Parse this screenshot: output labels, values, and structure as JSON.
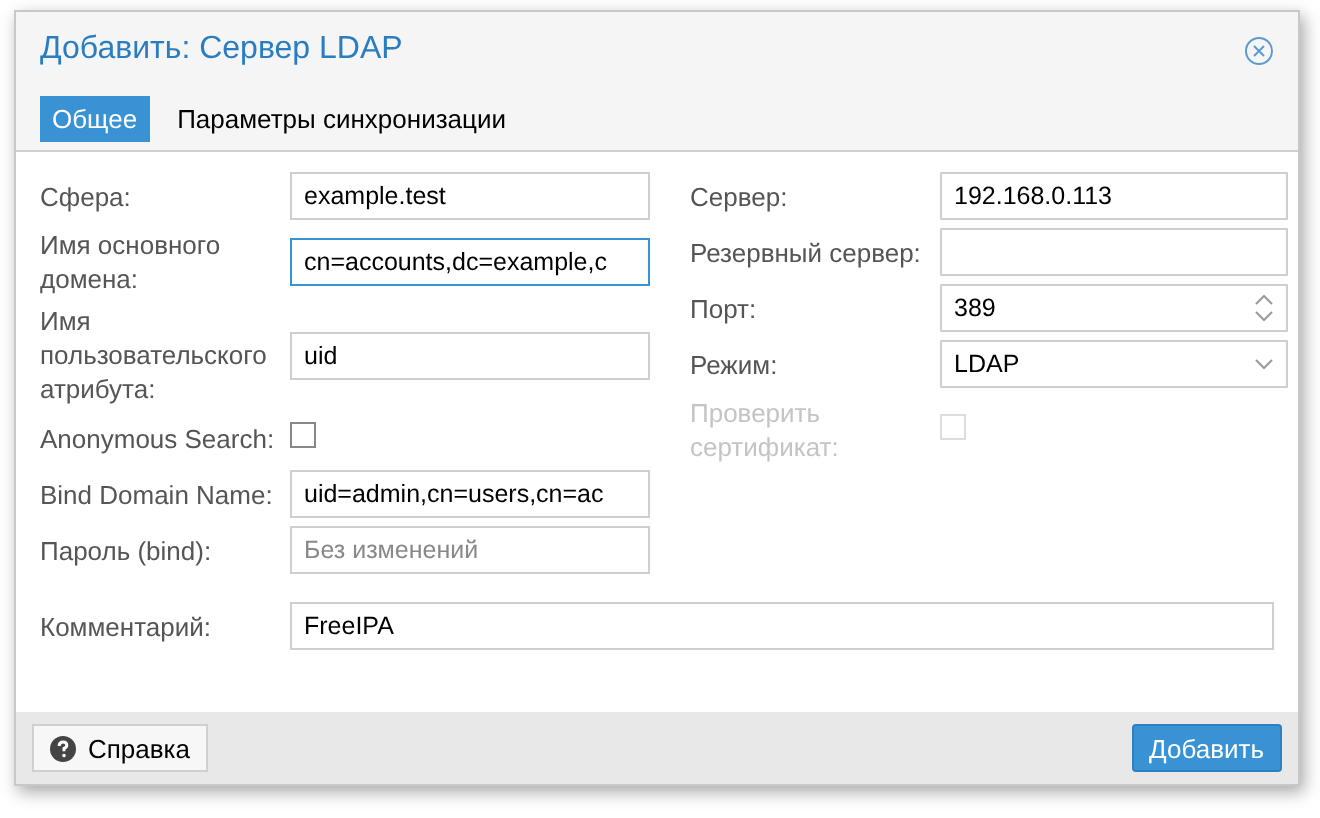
{
  "window": {
    "title": "Добавить: Сервер LDAP"
  },
  "tabs": [
    {
      "label": "Общее",
      "selected": true
    },
    {
      "label": "Параметры синхронизации",
      "selected": false
    }
  ],
  "left_fields": [
    {
      "kind": "text",
      "label": "Сфера:",
      "value": "example.test",
      "focused": false
    },
    {
      "kind": "text",
      "label": "Имя основного домена:",
      "value": "cn=accounts,dc=example,c",
      "focused": true
    },
    {
      "kind": "text",
      "label": "Имя пользовательского атрибута:",
      "value": "uid",
      "focused": false
    },
    {
      "kind": "checkbox",
      "label": "Anonymous Search:",
      "checked": false,
      "disabled": false
    },
    {
      "kind": "text",
      "label": "Bind Domain Name:",
      "value": "uid=admin,cn=users,cn=ac",
      "focused": false
    },
    {
      "kind": "text",
      "label": "Пароль (bind):",
      "placeholder": "Без изменений",
      "focused": false
    }
  ],
  "right_fields": [
    {
      "kind": "text",
      "label": "Сервер:",
      "value": "192.168.0.113",
      "focused": false
    },
    {
      "kind": "text",
      "label": "Резервный сервер:",
      "focused": false
    },
    {
      "kind": "number",
      "label": "Порт:",
      "value": "389"
    },
    {
      "kind": "select",
      "label": "Режим:",
      "value": "LDAP"
    },
    {
      "kind": "checkbox",
      "label": "Проверить сертификат:",
      "checked": false,
      "disabled": true
    }
  ],
  "comment": {
    "label": "Комментарий:",
    "value": "FreeIPA"
  },
  "buttons": {
    "help": "Справка",
    "submit": "Добавить"
  }
}
